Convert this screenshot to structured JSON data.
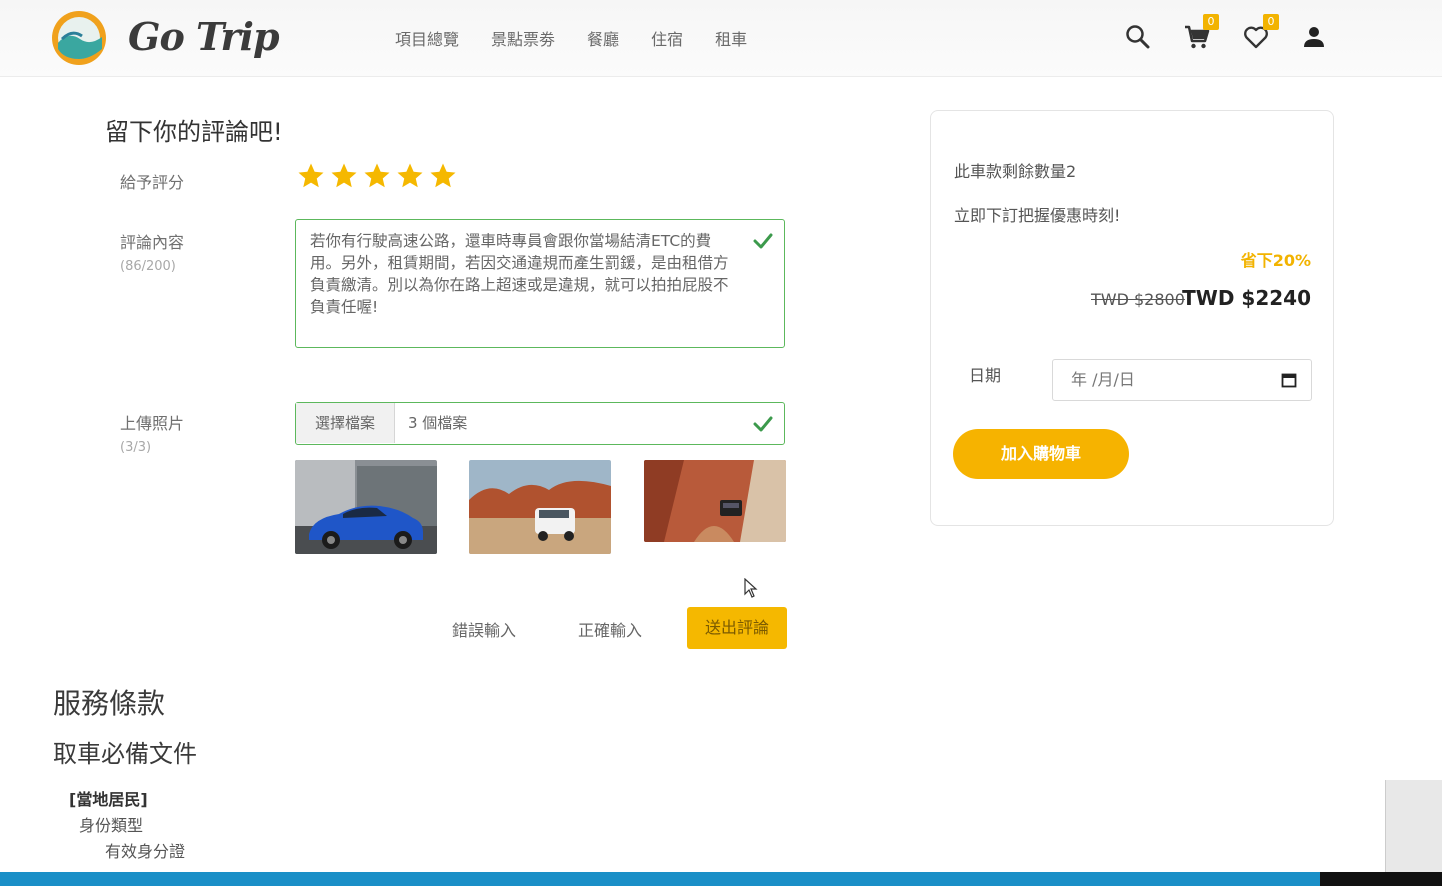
{
  "brand": {
    "name": "Go Trip"
  },
  "nav": {
    "items": [
      "項目總覽",
      "景點票劵",
      "餐廳",
      "住宿",
      "租車"
    ]
  },
  "header_icons": {
    "search": "search-icon",
    "cart": "cart-icon",
    "cart_count": "0",
    "wishlist": "heart-icon",
    "wishlist_count": "0",
    "user": "user-icon"
  },
  "review": {
    "title": "留下你的評論吧!",
    "rating_label": "給予評分",
    "rating": 5,
    "rating_max": 5,
    "content_label": "評論內容",
    "content_count": "(86/200)",
    "content_text": "若你有行駛高速公路，還車時專員會跟你當場結清ETC的費用。另外，租賃期間，若因交通違規而產生罰鍰，是由租借方負責繳清。別以為你在路上超速或是違規，就可以拍拍屁股不負責任喔!",
    "photo_label": "上傳照片",
    "photo_count": "(3/3)",
    "file_button": "選擇檔案",
    "file_status": "3 個檔案",
    "wrong_input": "錯誤輸入",
    "correct_input": "正確輸入",
    "submit": "送出評論"
  },
  "terms": {
    "title": "服務條款",
    "doc_title": "取車必備文件",
    "local_heading": "[當地居民]",
    "id_type": "身份類型",
    "id_valid": "有效身分證"
  },
  "card": {
    "stock": "此車款剩餘數量2",
    "promo": "立即下訂把握優惠時刻!",
    "discount": "省下20%",
    "price_old": "TWD $2800",
    "price_new": "TWD $2240",
    "date_label": "日期",
    "date_placeholder": "年 /月/日",
    "add_to_cart": "加入購物車"
  },
  "colors": {
    "accent": "#f5b800",
    "valid_green": "#5cb85c",
    "star": "#f5b800",
    "bottom_bar": "#1a8fc7"
  }
}
